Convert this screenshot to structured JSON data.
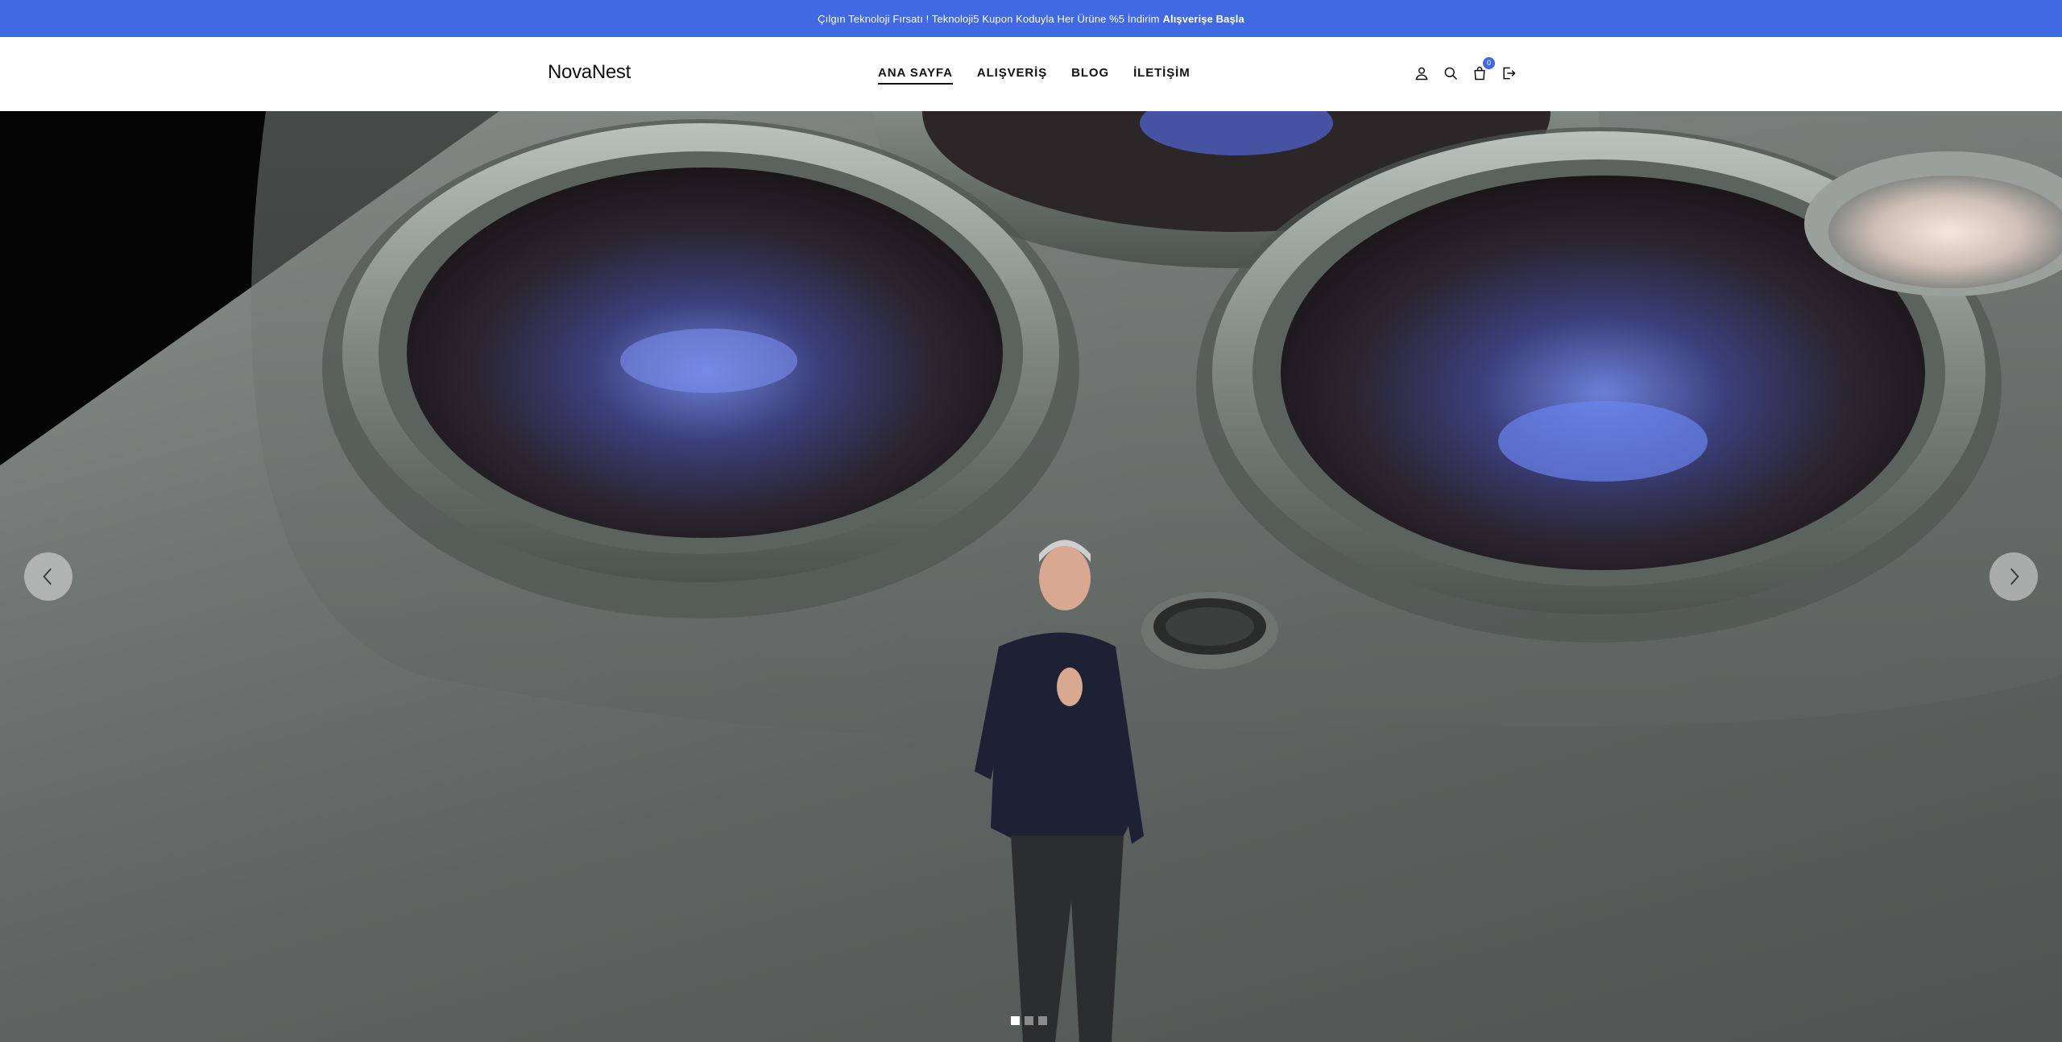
{
  "promo": {
    "text": "Çılgın Teknoloji Fırsatı ! Teknoloji5 Kupon Koduyla Her Ürüne %5 İndirim",
    "link": "Alışverişe Başla"
  },
  "header": {
    "logo": "NovaNest",
    "nav": [
      {
        "label": "ANA SAYFA",
        "active": true
      },
      {
        "label": "ALIŞVERİŞ",
        "active": false
      },
      {
        "label": "BLOG",
        "active": false
      },
      {
        "label": "İLETİŞİM",
        "active": false
      }
    ],
    "icons": [
      "user-icon",
      "search-icon",
      "cart-icon",
      "logout-icon"
    ],
    "cart_count": "0"
  },
  "hero": {
    "slides_total": 3,
    "active_slide": 1,
    "icons": {
      "prev": "chevron-left-icon",
      "next": "chevron-right-icon"
    }
  },
  "colors": {
    "accent": "#4169e1",
    "header_bg": "#ffffff",
    "text": "#111111"
  }
}
